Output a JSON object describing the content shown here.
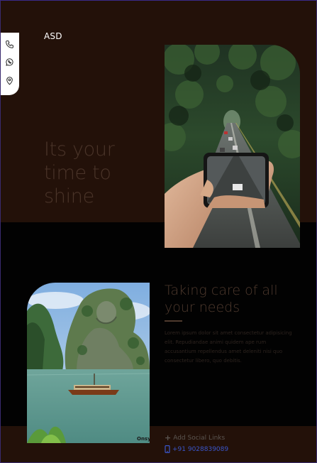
{
  "brand": {
    "logo_text": "ASD"
  },
  "side_nav": {
    "items": [
      {
        "icon": "phone-icon"
      },
      {
        "icon": "whatsapp-icon"
      },
      {
        "icon": "location-pin-icon"
      }
    ]
  },
  "hero": {
    "title": "Its your time to shine"
  },
  "section2": {
    "title": "Taking care of all your needs",
    "body": "Lorem ipsum dolor sit amet consectetur adipisicing elit. Repudiandae animi quidem ape rum accusantium repellendus amet deleniti nisi quo consectetur libero, quo debitis.",
    "image_watermark": "Onsy"
  },
  "footer": {
    "social_label": "Add Social Links",
    "phone": "+91 9028839089"
  },
  "colors": {
    "hero_bg": "#231109",
    "section_bg": "#020202",
    "heading": "#4f3a2e",
    "phone_link": "#3a55c8"
  }
}
